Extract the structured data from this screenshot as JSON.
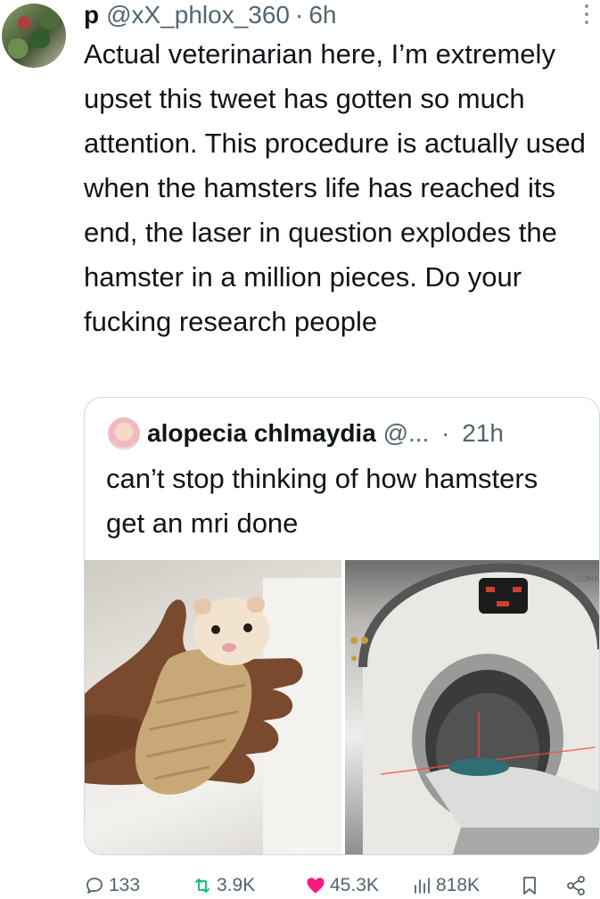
{
  "tweet": {
    "author_name": "p",
    "handle": "@xX_phlox_360",
    "separator": "·",
    "time": "6h",
    "more_icon": "more-vertical-icon",
    "text": "Actual veterinarian here, I’m extremely upset this tweet has gotten so much attention. This procedure is actually used when the hamsters life has reached its end, the laser in question explodes the hamster in a million pieces. Do your fucking research people"
  },
  "quote": {
    "author_name": "alopecia chlmaydia",
    "handle": "@...",
    "separator": "·",
    "time": "21h",
    "text": "can’t stop thinking of how hamsters get an mri done",
    "scanner_brand": "SOMA",
    "image_attribution": "@fluffyhamster"
  },
  "actions": {
    "replies": "133",
    "retweets": "3.9K",
    "likes": "45.3K",
    "views": "818K"
  },
  "colors": {
    "text": "#0f1419",
    "muted": "#536471",
    "like": "#f91880",
    "border": "#cfd9de"
  }
}
